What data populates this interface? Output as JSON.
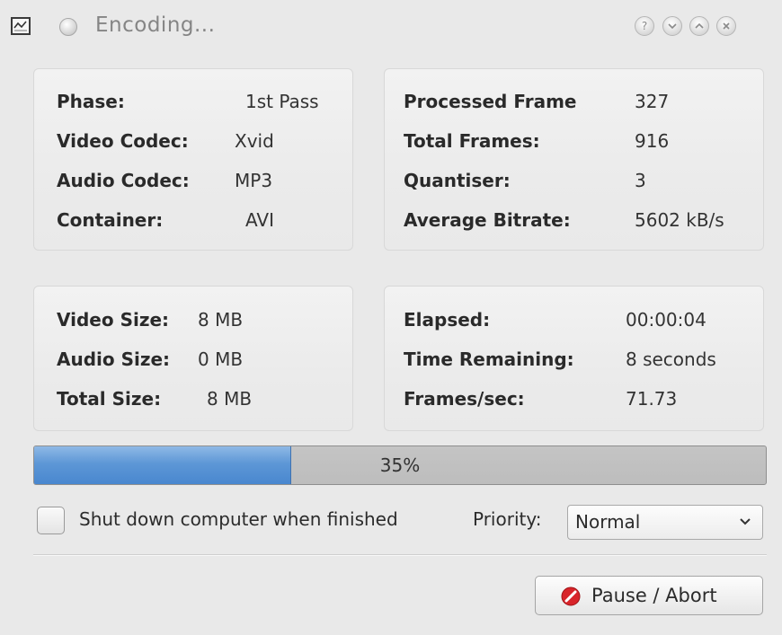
{
  "window": {
    "title": "Encoding...",
    "controls": [
      "help",
      "minimize",
      "maximize",
      "close"
    ]
  },
  "codec_panel": {
    "rows": [
      {
        "label": "Phase:",
        "value": "1st Pass"
      },
      {
        "label": "Video Codec:",
        "value": "Xvid"
      },
      {
        "label": "Audio Codec:",
        "value": "MP3"
      },
      {
        "label": "Container:",
        "value": "AVI"
      }
    ]
  },
  "frames_panel": {
    "rows": [
      {
        "label": "Processed Frame",
        "value": "327"
      },
      {
        "label": "Total Frames:",
        "value": "916"
      },
      {
        "label": "Quantiser:",
        "value": "3"
      },
      {
        "label": "Average Bitrate:",
        "value": "5602 kB/s"
      }
    ]
  },
  "size_panel": {
    "rows": [
      {
        "label": "Video Size:",
        "value": "8 MB"
      },
      {
        "label": "Audio Size:",
        "value": "0 MB"
      },
      {
        "label": "Total Size:",
        "value": "8 MB"
      }
    ]
  },
  "time_panel": {
    "rows": [
      {
        "label": "Elapsed:",
        "value": "00:00:04"
      },
      {
        "label": "Time Remaining:",
        "value": "8 seconds"
      },
      {
        "label": "Frames/sec:",
        "value": "71.73"
      }
    ]
  },
  "progress": {
    "percent": 35,
    "text": "35%"
  },
  "options": {
    "shutdown_label": "Shut down computer when finished",
    "shutdown_checked": false,
    "priority_label": "Priority:",
    "priority_value": "Normal"
  },
  "actions": {
    "pause_abort_label": "Pause / Abort"
  },
  "colors": {
    "progress_fill": "#5d97d6",
    "abort_icon": "#d8242a"
  }
}
